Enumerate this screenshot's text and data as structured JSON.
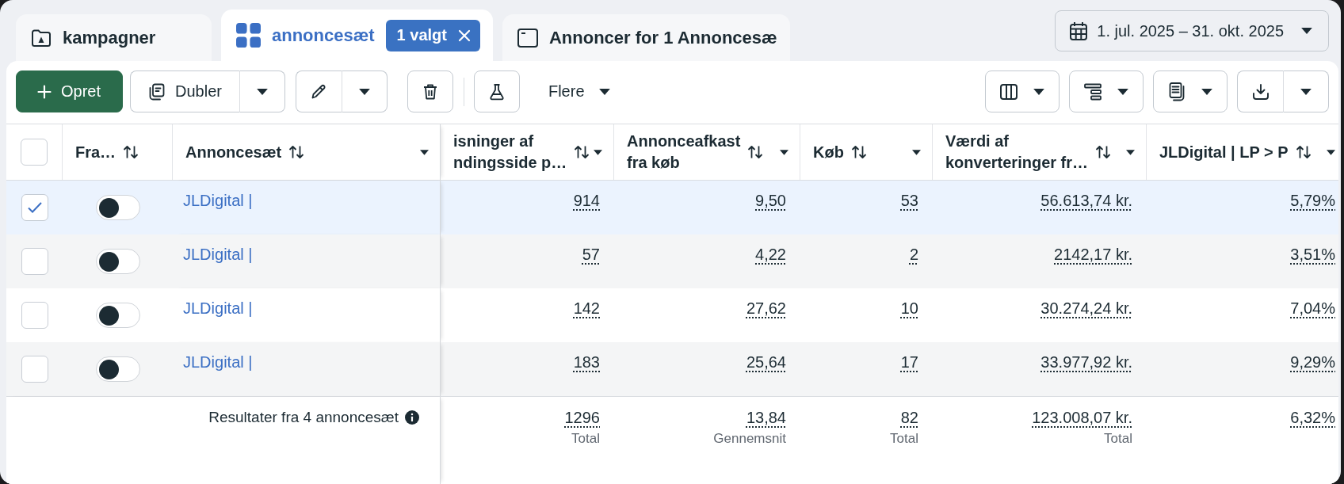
{
  "tabs": [
    {
      "kind": "campaigns",
      "label": "kampagner",
      "selected": false
    },
    {
      "kind": "ad_sets",
      "label": "annoncesæt",
      "selected": true,
      "badge": "1 valgt"
    },
    {
      "kind": "ads",
      "label": "Annoncer for 1 Annoncesæ",
      "selected": false
    }
  ],
  "date_range": {
    "label": "1. jul. 2025 – 31. okt. 2025"
  },
  "toolbar": {
    "create": "Opret",
    "duplicate": "Dubler",
    "more": "Flere"
  },
  "table": {
    "all_selected": false,
    "columns": [
      {
        "lines": [
          "Fra…"
        ],
        "menu": false
      },
      {
        "lines": [
          "Annoncesæt"
        ],
        "menu": true
      },
      {
        "lines": [
          "isninger af",
          "ndingsside p…"
        ],
        "menu": true
      },
      {
        "lines": [
          "Annonceafkast",
          "fra køb"
        ],
        "menu": true
      },
      {
        "lines": [
          "Køb"
        ],
        "menu": true
      },
      {
        "lines": [
          "Værdi af",
          "konverteringer fr…"
        ],
        "menu": true
      },
      {
        "lines": [
          "JLDigital | LP > P"
        ],
        "menu": true
      }
    ],
    "rows": [
      {
        "selected": true,
        "on": false,
        "name": "JLDigital |",
        "values": [
          "914",
          "9,50",
          "53",
          "56.613,74 kr.",
          "5,79%"
        ]
      },
      {
        "selected": false,
        "on": false,
        "name": "JLDigital |",
        "values": [
          "57",
          "4,22",
          "2",
          "2142,17 kr.",
          "3,51%"
        ]
      },
      {
        "selected": false,
        "on": false,
        "name": "JLDigital |",
        "values": [
          "142",
          "27,62",
          "10",
          "30.274,24 kr.",
          "7,04%"
        ]
      },
      {
        "selected": false,
        "on": false,
        "name": "JLDigital |",
        "values": [
          "183",
          "25,64",
          "17",
          "33.977,92 kr.",
          "9,29%"
        ]
      }
    ],
    "summary": {
      "label": "Resultater fra 4 annoncesæt",
      "totals": [
        {
          "value": "1296",
          "note": "Total"
        },
        {
          "value": "13,84",
          "note": "Gennemsnit"
        },
        {
          "value": "82",
          "note": "Total"
        },
        {
          "value": "123.008,07 kr.",
          "note": "Total"
        },
        {
          "value": "6,32%"
        }
      ]
    }
  }
}
